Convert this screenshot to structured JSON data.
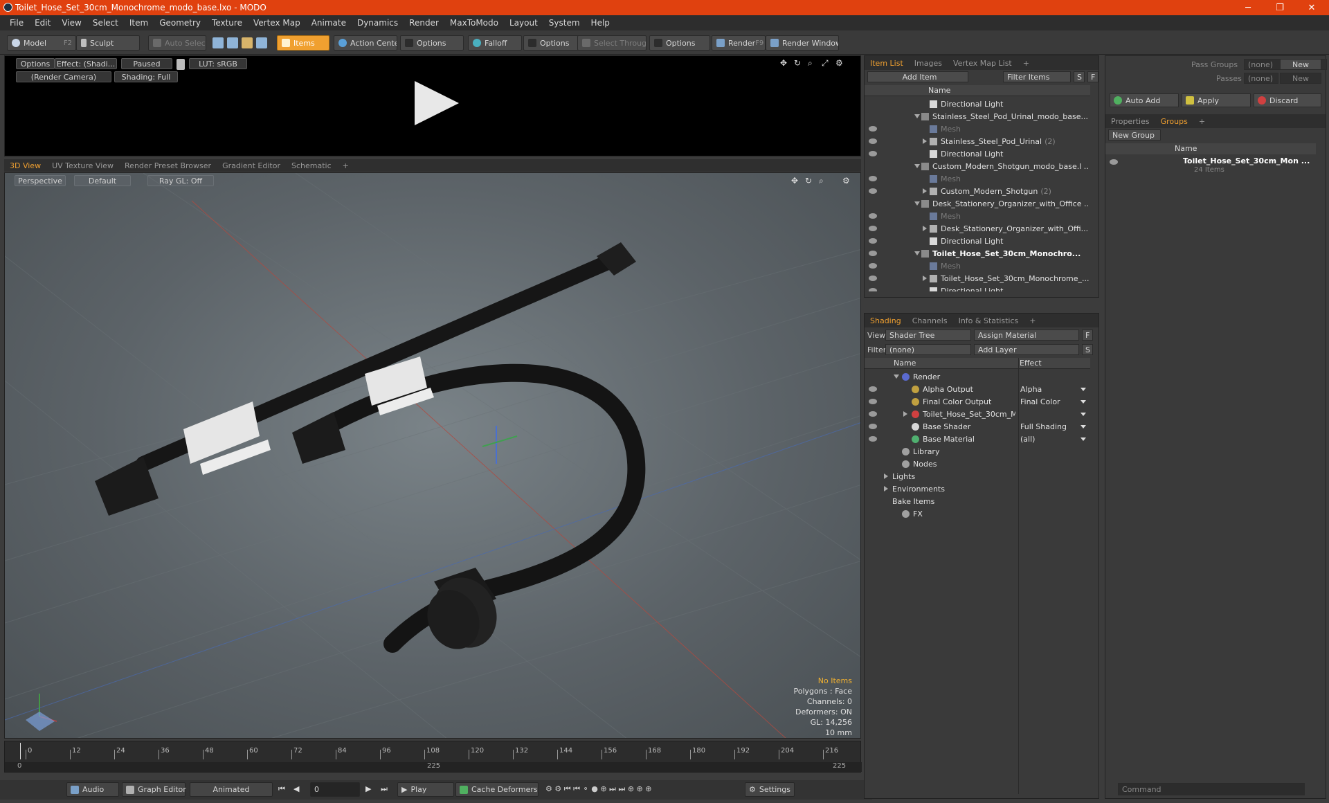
{
  "window": {
    "title": "Toilet_Hose_Set_30cm_Monochrome_modo_base.lxo - MODO",
    "minimize": "─",
    "maximize": "❐",
    "close": "✕"
  },
  "menu": [
    "File",
    "Edit",
    "View",
    "Select",
    "Item",
    "Geometry",
    "Texture",
    "Vertex Map",
    "Animate",
    "Dynamics",
    "Render",
    "MaxToModo",
    "Layout",
    "System",
    "Help"
  ],
  "toolbar": {
    "model": "Model",
    "model_key": "F2",
    "sculpt": "Sculpt",
    "auto_select": "Auto Select",
    "items": "Items",
    "action_center": "Action Center",
    "options1": "Options",
    "falloff": "Falloff",
    "options2": "Options",
    "select_through": "Select Through",
    "options3": "Options",
    "render": "Render",
    "render_key": "F9",
    "render_window": "Render Window"
  },
  "render_preview": {
    "options": "Options",
    "effect": "Effect: (Shadi...",
    "paused": "Paused",
    "lut": "LUT: sRGB",
    "camera": "(Render Camera)",
    "shading": "Shading: Full"
  },
  "viewport_tabs": [
    "3D View",
    "UV Texture View",
    "Render Preset Browser",
    "Gradient Editor",
    "Schematic",
    "+"
  ],
  "viewport": {
    "projection": "Perspective",
    "style": "Default",
    "raygl": "Ray GL: Off",
    "info": {
      "items": "No Items",
      "polygons": "Polygons : Face",
      "channels": "Channels: 0",
      "deformers": "Deformers: ON",
      "gl": "GL: 14,256",
      "scale": "10 mm"
    }
  },
  "timeline": {
    "ticks": [
      "0",
      "12",
      "24",
      "36",
      "48",
      "60",
      "72",
      "84",
      "96",
      "108",
      "120",
      "132",
      "144",
      "156",
      "168",
      "180",
      "192",
      "204",
      "216"
    ],
    "start": "0",
    "mid": "225",
    "end": "225"
  },
  "bottom": {
    "audio": "Audio",
    "graph_editor": "Graph Editor",
    "animated": "Animated",
    "frame": "0",
    "play": "Play",
    "cache_deformers": "Cache Deformers",
    "settings": "Settings"
  },
  "item_list": {
    "tabs": [
      "Item List",
      "Images",
      "Vertex Map List",
      "+"
    ],
    "add_item": "Add Item",
    "filter_items": "Filter Items",
    "s": "S",
    "f": "F",
    "col_name": "Name",
    "rows": [
      {
        "name": "Directional Light",
        "indent": 2,
        "kind": "light",
        "dim": false,
        "bold": false,
        "eye": false,
        "tri": ""
      },
      {
        "name": "Stainless_Steel_Pod_Urinal_modo_base....",
        "indent": 1,
        "kind": "scene",
        "dim": false,
        "bold": false,
        "eye": false,
        "tri": "down"
      },
      {
        "name": "Mesh",
        "indent": 2,
        "kind": "mesh",
        "dim": true,
        "bold": false,
        "eye": true,
        "tri": ""
      },
      {
        "name": "Stainless_Steel_Pod_Urinal",
        "sub": "(2)",
        "indent": 2,
        "kind": "group",
        "dim": false,
        "bold": false,
        "eye": true,
        "tri": "right"
      },
      {
        "name": "Directional Light",
        "indent": 2,
        "kind": "light",
        "dim": false,
        "bold": false,
        "eye": true,
        "tri": ""
      },
      {
        "name": "Custom_Modern_Shotgun_modo_base.l ...",
        "indent": 1,
        "kind": "scene",
        "dim": false,
        "bold": false,
        "eye": false,
        "tri": "down"
      },
      {
        "name": "Mesh",
        "indent": 2,
        "kind": "mesh",
        "dim": true,
        "bold": false,
        "eye": true,
        "tri": ""
      },
      {
        "name": "Custom_Modern_Shotgun",
        "sub": "(2)",
        "indent": 2,
        "kind": "group",
        "dim": false,
        "bold": false,
        "eye": true,
        "tri": "right"
      },
      {
        "name": "Desk_Stationery_Organizer_with_Office ...",
        "indent": 1,
        "kind": "scene",
        "dim": false,
        "bold": false,
        "eye": false,
        "tri": "down"
      },
      {
        "name": "Mesh",
        "indent": 2,
        "kind": "mesh",
        "dim": true,
        "bold": false,
        "eye": true,
        "tri": ""
      },
      {
        "name": "Desk_Stationery_Organizer_with_Offi...",
        "indent": 2,
        "kind": "group",
        "dim": false,
        "bold": false,
        "eye": true,
        "tri": "right"
      },
      {
        "name": "Directional Light",
        "indent": 2,
        "kind": "light",
        "dim": false,
        "bold": false,
        "eye": true,
        "tri": ""
      },
      {
        "name": "Toilet_Hose_Set_30cm_Monochro...",
        "indent": 1,
        "kind": "scene",
        "dim": false,
        "bold": true,
        "eye": true,
        "tri": "down"
      },
      {
        "name": "Mesh",
        "indent": 2,
        "kind": "mesh",
        "dim": true,
        "bold": false,
        "eye": true,
        "tri": ""
      },
      {
        "name": "Toilet_Hose_Set_30cm_Monochrome_...",
        "indent": 2,
        "kind": "group",
        "dim": false,
        "bold": false,
        "eye": true,
        "tri": "right"
      },
      {
        "name": "Directional Light",
        "indent": 2,
        "kind": "light",
        "dim": false,
        "bold": false,
        "eye": true,
        "tri": ""
      }
    ]
  },
  "shading": {
    "tabs": [
      "Shading",
      "Channels",
      "Info & Statistics",
      "+"
    ],
    "view_label": "View",
    "view_value": "Shader Tree",
    "assign_material": "Assign Material",
    "filter_label": "Filter",
    "filter_value": "(none)",
    "add_layer": "Add Layer",
    "f": "F",
    "s": "S",
    "col_name": "Name",
    "col_effect": "Effect",
    "rows": [
      {
        "name": "Render",
        "effect": "",
        "indent": 1,
        "tri": "down",
        "eye": false,
        "color": "#5a6ad0",
        "dd": false
      },
      {
        "name": "Alpha Output",
        "effect": "Alpha",
        "indent": 2,
        "tri": "",
        "eye": true,
        "color": "#c0a040",
        "dd": true
      },
      {
        "name": "Final Color Output",
        "effect": "Final Color",
        "indent": 2,
        "tri": "",
        "eye": true,
        "color": "#c0a040",
        "dd": true
      },
      {
        "name": "Toilet_Hose_Set_30cm_Mo...",
        "effect": "",
        "indent": 2,
        "tri": "right",
        "eye": true,
        "color": "#d04040",
        "dd": true
      },
      {
        "name": "Base Shader",
        "effect": "Full Shading",
        "indent": 2,
        "tri": "",
        "eye": true,
        "color": "#d8d8d8",
        "dd": true
      },
      {
        "name": "Base Material",
        "effect": "(all)",
        "indent": 2,
        "tri": "",
        "eye": true,
        "color": "#50b070",
        "dd": true
      },
      {
        "name": "Library",
        "effect": "",
        "indent": 1,
        "tri": "",
        "eye": false,
        "color": "#a0a0a0",
        "dd": false
      },
      {
        "name": "Nodes",
        "effect": "",
        "indent": 1,
        "tri": "",
        "eye": false,
        "color": "#a0a0a0",
        "dd": false
      },
      {
        "name": "Lights",
        "effect": "",
        "indent": 0,
        "tri": "right",
        "eye": false,
        "color": "",
        "dd": false
      },
      {
        "name": "Environments",
        "effect": "",
        "indent": 0,
        "tri": "right",
        "eye": false,
        "color": "",
        "dd": false
      },
      {
        "name": "Bake Items",
        "effect": "",
        "indent": 0,
        "tri": "",
        "eye": false,
        "color": "",
        "dd": false
      },
      {
        "name": "FX",
        "effect": "",
        "indent": 1,
        "tri": "",
        "eye": false,
        "color": "#a0a0a0",
        "dd": false
      }
    ]
  },
  "groups": {
    "pass_groups_label": "Pass Groups",
    "pass_groups_value": "(none)",
    "passes_label": "Passes",
    "passes_value": "(none)",
    "new1": "New",
    "new2": "New",
    "auto_add": "Auto Add",
    "apply": "Apply",
    "discard": "Discard",
    "tabs": [
      "Properties",
      "Groups",
      "+"
    ],
    "new_group": "New Group",
    "col_name": "Name",
    "item_name": "Toilet_Hose_Set_30cm_Mon ...",
    "item_count": "24 Items",
    "command_placeholder": "Command"
  },
  "colors": {
    "accent": "#f0a030",
    "titlebar": "#e0410f"
  }
}
